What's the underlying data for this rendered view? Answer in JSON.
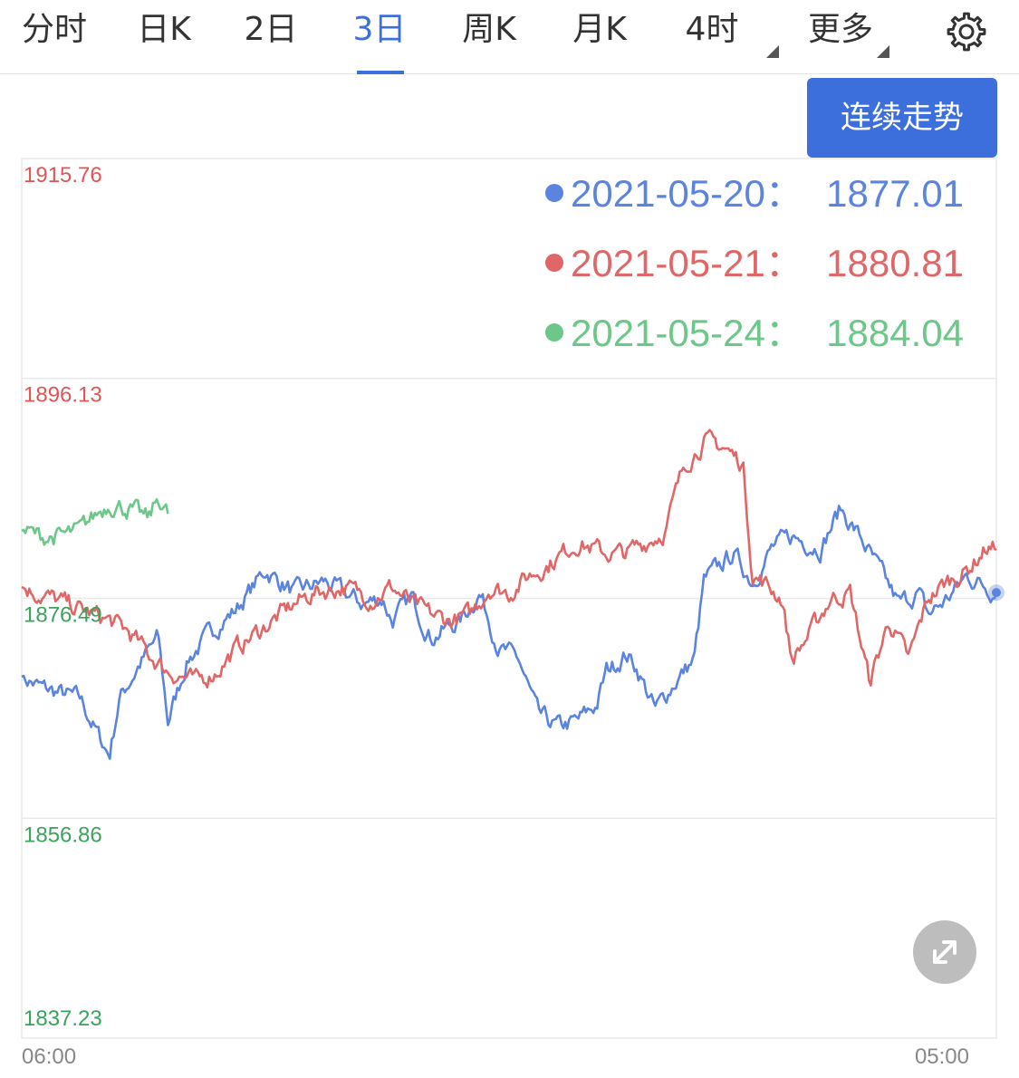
{
  "tabs": [
    {
      "label": "分时",
      "active": false,
      "has_dropdown": false
    },
    {
      "label": "日K",
      "active": false,
      "has_dropdown": false
    },
    {
      "label": "2日",
      "active": false,
      "has_dropdown": false
    },
    {
      "label": "3日",
      "active": true,
      "has_dropdown": false
    },
    {
      "label": "周K",
      "active": false,
      "has_dropdown": false
    },
    {
      "label": "月K",
      "active": false,
      "has_dropdown": false
    },
    {
      "label": "4时",
      "active": false,
      "has_dropdown": true
    },
    {
      "label": "更多",
      "active": false,
      "has_dropdown": true
    }
  ],
  "settings_icon": "gear-icon",
  "trend_button_label": "连续走势",
  "expand_icon": "expand-icon",
  "colors": {
    "accent": "#3d6fdc",
    "blue": "#5b84e0",
    "red": "#e06767",
    "green": "#6cc788",
    "label_red": "#e05555",
    "label_green": "#3aa35c",
    "grid": "#e8e8e8",
    "axis_text": "#888888"
  },
  "chart_data": {
    "type": "line",
    "title": "",
    "xlabel": "",
    "ylabel": "",
    "x_range": [
      "06:00",
      "05:00"
    ],
    "x_tick_labels": [
      "06:00",
      "05:00"
    ],
    "ylim": [
      1837.23,
      1915.76
    ],
    "y_tick_labels": [
      "1915.76",
      "1896.13",
      "1876.49",
      "1856.86",
      "1837.23"
    ],
    "grid": true,
    "legend_position": "top-right",
    "legend": [
      {
        "date": "2021-05-20",
        "separator": "：",
        "value": "1877.01",
        "color": "#5b84e0"
      },
      {
        "date": "2021-05-21",
        "separator": "：",
        "value": "1880.81",
        "color": "#e06767"
      },
      {
        "date": "2021-05-24",
        "separator": "：",
        "value": "1884.04",
        "color": "#6cc788"
      }
    ],
    "series": [
      {
        "color": "#5b84e0",
        "end_marker": true,
        "x": [
          0,
          0.02,
          0.04,
          0.06,
          0.08,
          0.09,
          0.1,
          0.12,
          0.14,
          0.15,
          0.17,
          0.2,
          0.22,
          0.25,
          0.28,
          0.31,
          0.33,
          0.35,
          0.37,
          0.38,
          0.4,
          0.42,
          0.45,
          0.47,
          0.49,
          0.51,
          0.53,
          0.55,
          0.57,
          0.59,
          0.6,
          0.62,
          0.63,
          0.65,
          0.67,
          0.69,
          0.7,
          0.73,
          0.75,
          0.77,
          0.79,
          0.82,
          0.84,
          0.86,
          0.88,
          0.9,
          0.92,
          0.93,
          0.95,
          0.97,
          1.0
        ],
        "y": [
          1869.5,
          1868.5,
          1868.0,
          1867.5,
          1864.0,
          1862.5,
          1867.5,
          1870.5,
          1873.0,
          1865.5,
          1871.0,
          1874.0,
          1875.5,
          1879.0,
          1877.0,
          1878.0,
          1877.0,
          1876.0,
          1876.5,
          1874.5,
          1876.5,
          1873.0,
          1874.5,
          1877.0,
          1872.0,
          1871.0,
          1866.0,
          1865.0,
          1865.5,
          1867.0,
          1870.0,
          1871.5,
          1870.5,
          1866.5,
          1869.0,
          1871.0,
          1878.0,
          1880.5,
          1878.0,
          1881.0,
          1882.0,
          1881.0,
          1884.5,
          1882.0,
          1879.0,
          1876.0,
          1877.0,
          1875.0,
          1876.5,
          1878.5,
          1877.01
        ]
      },
      {
        "color": "#e06767",
        "end_marker": false,
        "x": [
          0,
          0.03,
          0.06,
          0.09,
          0.11,
          0.13,
          0.15,
          0.18,
          0.2,
          0.22,
          0.25,
          0.28,
          0.3,
          0.33,
          0.36,
          0.38,
          0.4,
          0.42,
          0.44,
          0.46,
          0.48,
          0.5,
          0.52,
          0.54,
          0.57,
          0.6,
          0.62,
          0.64,
          0.66,
          0.68,
          0.7,
          0.72,
          0.74,
          0.75,
          0.76,
          0.78,
          0.79,
          0.81,
          0.83,
          0.85,
          0.87,
          0.89,
          0.91,
          0.93,
          0.95,
          0.97,
          0.99,
          1.0
        ],
        "y": [
          1877.5,
          1876.5,
          1875.5,
          1874.5,
          1873.5,
          1871.5,
          1870.0,
          1869.0,
          1870.0,
          1872.0,
          1874.0,
          1876.0,
          1877.0,
          1877.5,
          1876.5,
          1877.5,
          1876.0,
          1875.0,
          1874.5,
          1875.0,
          1877.5,
          1877.0,
          1878.5,
          1879.5,
          1881.5,
          1880.5,
          1880.5,
          1881.5,
          1882.5,
          1888.5,
          1890.5,
          1890.0,
          1888.5,
          1878.5,
          1878.0,
          1876.5,
          1871.0,
          1873.5,
          1876.5,
          1877.0,
          1869.0,
          1874.5,
          1871.0,
          1876.5,
          1878.0,
          1879.0,
          1881.0,
          1880.81
        ]
      },
      {
        "color": "#6cc788",
        "end_marker": false,
        "x": [
          0,
          0.02,
          0.04,
          0.06,
          0.07,
          0.09,
          0.11,
          0.13,
          0.14,
          0.15
        ],
        "y": [
          1882.5,
          1882.0,
          1882.0,
          1882.5,
          1883.5,
          1885.0,
          1884.5,
          1883.5,
          1885.5,
          1884.04
        ]
      }
    ]
  }
}
